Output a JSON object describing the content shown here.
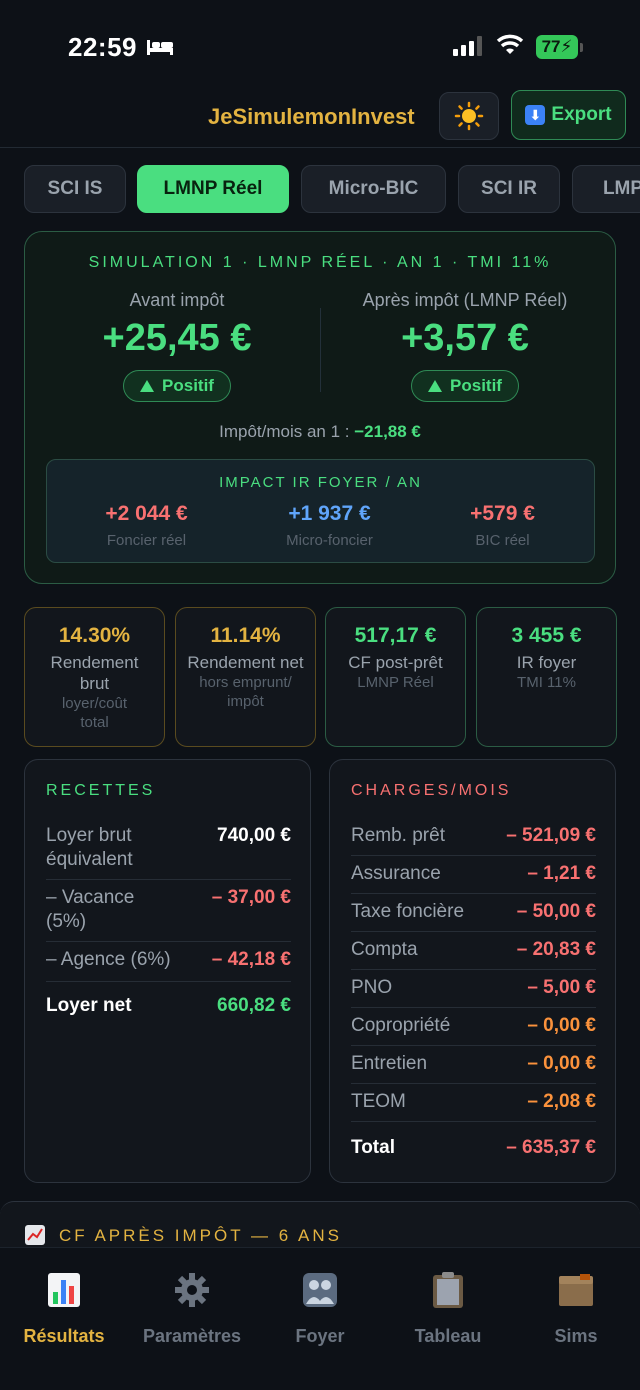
{
  "status": {
    "time": "22:59",
    "battery": "77"
  },
  "header": {
    "brand": "JeSimulemonInvest",
    "export_label": "Export"
  },
  "tabs": [
    {
      "label": "SCI IS",
      "active": false
    },
    {
      "label": "LMNP Réel",
      "active": true
    },
    {
      "label": "Micro-BIC",
      "active": false
    },
    {
      "label": "SCI IR",
      "active": false
    },
    {
      "label": "LMP",
      "active": false
    }
  ],
  "simulation": {
    "title": "SIMULATION 1 · LMNP RÉEL · AN 1 · TMI 11%",
    "before": {
      "label": "Avant impôt",
      "value": "+25,45 €",
      "badge": "Positif"
    },
    "after": {
      "label": "Après impôt (LMNP Réel)",
      "value": "+3,57 €",
      "badge": "Positif"
    },
    "tax_month_label": "Impôt/mois an 1 :",
    "tax_month_value": "−21,88 €",
    "impact": {
      "title": "IMPACT IR FOYER / AN",
      "items": [
        {
          "value": "+2 044 €",
          "label": "Foncier réel",
          "color": "#f87171"
        },
        {
          "value": "+1 937 €",
          "label": "Micro-foncier",
          "color": "#60a5fa"
        },
        {
          "value": "+579 €",
          "label": "BIC réel",
          "color": "#f87171"
        }
      ]
    }
  },
  "metrics": [
    {
      "value": "14.30%",
      "label": "Rendement brut",
      "sub": "loyer/coût total",
      "color": "#e3b341"
    },
    {
      "value": "11.14%",
      "label": "Rendement net",
      "sub": "hors emprunt/ impôt",
      "color": "#e3b341"
    },
    {
      "value": "517,17 €",
      "label": "CF post-prêt",
      "sub": "LMNP Réel",
      "color": "#4ade80"
    },
    {
      "value": "3 455 €",
      "label": "IR foyer",
      "sub": "TMI 11%",
      "color": "#4ade80"
    }
  ],
  "recettes": {
    "title": "RECETTES",
    "rows": [
      {
        "label": "Loyer brut équivalent",
        "value": "740,00 €",
        "color": "#ffffff"
      },
      {
        "label": "– Vacance (5%)",
        "value": "– 37,00 €",
        "color": "#f87171"
      },
      {
        "label": "– Agence (6%)",
        "value": "– 42,18 €",
        "color": "#f87171"
      },
      {
        "label": "Loyer net",
        "value": "660,82 €",
        "color": "#4ade80"
      }
    ]
  },
  "charges": {
    "title": "CHARGES/MOIS",
    "rows": [
      {
        "label": "Remb. prêt",
        "value": "– 521,09 €",
        "color": "#f87171"
      },
      {
        "label": "Assurance",
        "value": "– 1,21 €",
        "color": "#f87171"
      },
      {
        "label": "Taxe foncière",
        "value": "– 50,00 €",
        "color": "#f87171"
      },
      {
        "label": "Compta",
        "value": "– 20,83 €",
        "color": "#f87171"
      },
      {
        "label": "PNO",
        "value": "– 5,00 €",
        "color": "#f87171"
      },
      {
        "label": "Copropriété",
        "value": "– 0,00 €",
        "color": "#fb923c"
      },
      {
        "label": "Entretien",
        "value": "– 0,00 €",
        "color": "#fb923c"
      },
      {
        "label": "TEOM",
        "value": "– 2,08 €",
        "color": "#fb923c"
      },
      {
        "label": "Total",
        "value": "– 635,37 €",
        "color": "#f87171"
      }
    ]
  },
  "cf_section": {
    "title": "CF APRÈS IMPÔT — 6 ANS"
  },
  "nav": [
    {
      "label": "Résultats",
      "icon": "chart-icon",
      "active": true
    },
    {
      "label": "Paramètres",
      "icon": "gear-icon",
      "active": false
    },
    {
      "label": "Foyer",
      "icon": "people-icon",
      "active": false
    },
    {
      "label": "Tableau",
      "icon": "clipboard-icon",
      "active": false
    },
    {
      "label": "Sims",
      "icon": "box-icon",
      "active": false
    }
  ]
}
